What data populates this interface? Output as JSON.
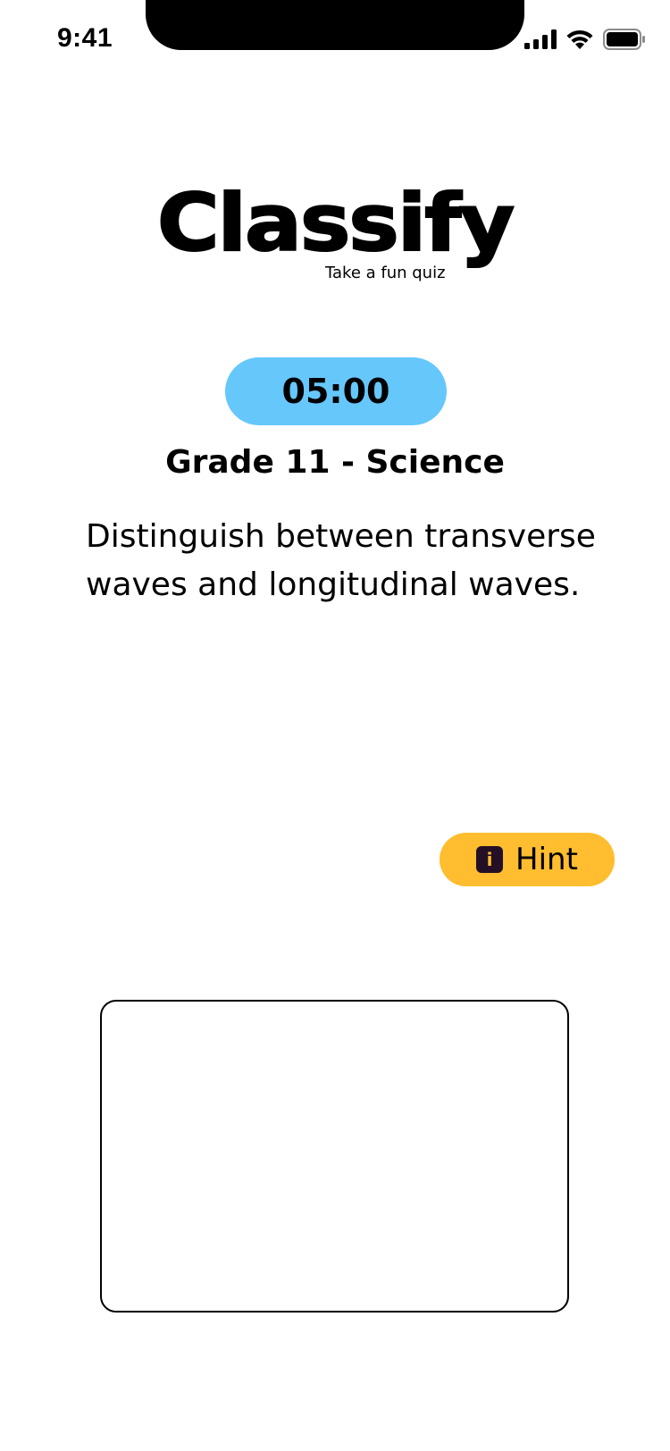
{
  "status_bar": {
    "time": "9:41",
    "icons": [
      "cellular-signal-icon",
      "wifi-icon",
      "battery-icon"
    ]
  },
  "logo": {
    "title": "Classify",
    "tagline": "Take a fun quiz"
  },
  "timer": {
    "value": "05:00",
    "color": "#66c7fb"
  },
  "subject": "Grade 11 - Science",
  "question": "Distinguish between transverse waves and longitudinal waves.",
  "hint_button": {
    "label": "Hint",
    "icon": "info-icon",
    "icon_glyph": "i",
    "color": "#ffbd2f"
  },
  "answer_box": {
    "value": ""
  }
}
